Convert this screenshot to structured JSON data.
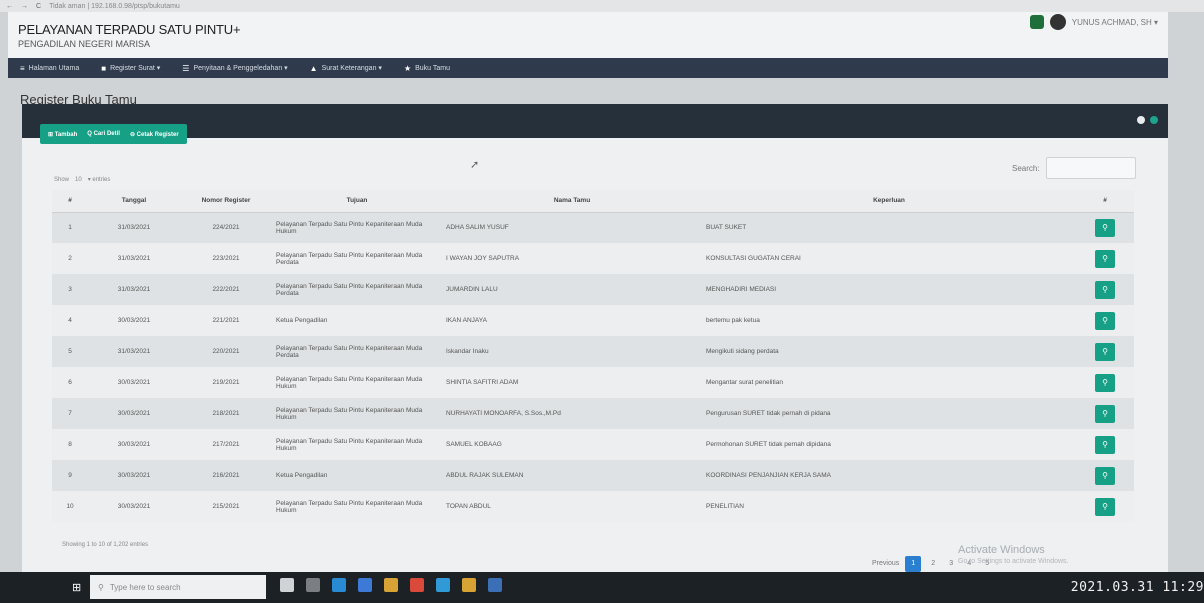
{
  "browser": {
    "back": "←",
    "forward": "→",
    "reload": "C",
    "url": "Tidak aman | 192.168.0.98/ptsp/bukutamu"
  },
  "header": {
    "title": "PELAYANAN TERPADU SATU PINTU+",
    "subtitle": "PENGADILAN NEGERI MARISA",
    "user": "YUNUS ACHMAD, SH ▾"
  },
  "nav": {
    "items": [
      {
        "icon": "≡",
        "label": "Halaman Utama"
      },
      {
        "icon": "■",
        "label": "Register Surat ▾"
      },
      {
        "icon": "☰",
        "label": "Penyitaan & Penggeledahan ▾"
      },
      {
        "icon": "▲",
        "label": "Surat Keterangan ▾"
      },
      {
        "icon": "★",
        "label": "Buku Tamu"
      }
    ]
  },
  "page": {
    "title": "Register Buku Tamu"
  },
  "toolbar": {
    "add": "⊞ Tambah",
    "search": "Q Cari Detil",
    "print": "⊖ Cetak Register"
  },
  "table_controls": {
    "show": "Show",
    "length_value": "10",
    "entries": "▾ entries",
    "search_label": "Search:"
  },
  "table": {
    "headers": [
      "#",
      "Tanggal",
      "Nomor Register",
      "Tujuan",
      "Nama Tamu",
      "Keperluan",
      "#"
    ],
    "rows": [
      {
        "no": "1",
        "tanggal": "31/03/2021",
        "nomor": "224/2021",
        "tujuan": "Pelayanan Terpadu Satu Pintu Kepaniteraan Muda Hukum",
        "nama": "ADHA SALIM YUSUF",
        "keperluan": "BUAT SUKET"
      },
      {
        "no": "2",
        "tanggal": "31/03/2021",
        "nomor": "223/2021",
        "tujuan": "Pelayanan Terpadu Satu Pintu Kepaniteraan Muda Perdata",
        "nama": "I WAYAN JOY SAPUTRA",
        "keperluan": "KONSULTASI GUGATAN CERAI"
      },
      {
        "no": "3",
        "tanggal": "31/03/2021",
        "nomor": "222/2021",
        "tujuan": "Pelayanan Terpadu Satu Pintu Kepaniteraan Muda Perdata",
        "nama": "JUMARDIN LALU",
        "keperluan": "MENGHADIRI MEDIASI"
      },
      {
        "no": "4",
        "tanggal": "30/03/2021",
        "nomor": "221/2021",
        "tujuan": "Ketua Pengadilan",
        "nama": "IKAN ANJAYA",
        "keperluan": "bertemu pak ketua"
      },
      {
        "no": "5",
        "tanggal": "31/03/2021",
        "nomor": "220/2021",
        "tujuan": "Pelayanan Terpadu Satu Pintu Kepaniteraan Muda Perdata",
        "nama": "Iskandar Inaku",
        "keperluan": "Mengikuti sidang perdata"
      },
      {
        "no": "6",
        "tanggal": "30/03/2021",
        "nomor": "219/2021",
        "tujuan": "Pelayanan Terpadu Satu Pintu Kepaniteraan Muda Hukum",
        "nama": "SHINTIA SAFITRI ADAM",
        "keperluan": "Mengantar surat penelitian"
      },
      {
        "no": "7",
        "tanggal": "30/03/2021",
        "nomor": "218/2021",
        "tujuan": "Pelayanan Terpadu Satu Pintu Kepaniteraan Muda Hukum",
        "nama": "NURHAYATI MONOARFA, S.Sos.,M.Pd",
        "keperluan": "Pengurusan SURET tidak pernah di pidana"
      },
      {
        "no": "8",
        "tanggal": "30/03/2021",
        "nomor": "217/2021",
        "tujuan": "Pelayanan Terpadu Satu Pintu Kepaniteraan Muda Hukum",
        "nama": "SAMUEL KOBAAG",
        "keperluan": "Permohonan SURET tidak pernah dipidana"
      },
      {
        "no": "9",
        "tanggal": "30/03/2021",
        "nomor": "216/2021",
        "tujuan": "Ketua Pengadilan",
        "nama": "ABDUL RAJAK SULEMAN",
        "keperluan": "KOORDINASI PENJANJIAN KERJA SAMA"
      },
      {
        "no": "10",
        "tanggal": "30/03/2021",
        "nomor": "215/2021",
        "tujuan": "Pelayanan Terpadu Satu Pintu Kepaniteraan Muda Hukum",
        "nama": "TOPAN ABDUL",
        "keperluan": "PENELITIAN"
      }
    ],
    "action_icon": "⚲"
  },
  "table_info": "Showing 1 to 10 of 1,202 entries",
  "pagination": {
    "previous": "Previous",
    "pages": [
      "1",
      "2",
      "3",
      "4",
      "5"
    ],
    "active": "1"
  },
  "watermark": {
    "title": "Activate Windows",
    "subtitle": "Go to Settings to activate Windows."
  },
  "taskbar": {
    "search_placeholder": "Type here to search",
    "clock": "2021.03.31 11:29"
  }
}
